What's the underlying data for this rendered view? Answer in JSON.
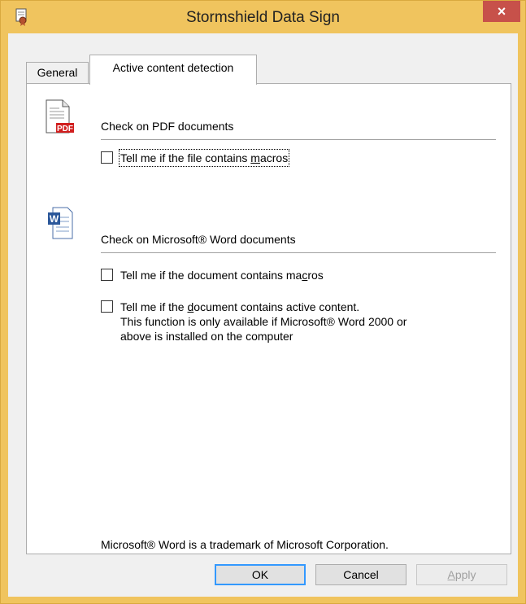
{
  "window": {
    "title": "Stormshield Data Sign",
    "close_glyph": "×",
    "app_icon": "certificate-seal-icon"
  },
  "tabs": [
    {
      "label": "General",
      "active": false
    },
    {
      "label": "Active content detection",
      "active": true
    }
  ],
  "pdf_section": {
    "icon": "pdf-document-icon",
    "heading": "Check on PDF documents",
    "option_macros": {
      "pre": "Tell me if the file contains ",
      "u": "m",
      "post": "acros",
      "checked": false
    }
  },
  "word_section": {
    "icon": "word-document-icon",
    "heading": "Check on Microsoft® Word documents",
    "option_macros": {
      "pre": "Tell me if the document contains ma",
      "u": "c",
      "post": "ros",
      "checked": false
    },
    "option_active": {
      "pre": "Tell me if the ",
      "u": "d",
      "post": "ocument contains active content.",
      "line2": "This function is only available if Microsoft® Word 2000 or",
      "line3": "above is installed on the computer",
      "checked": false
    }
  },
  "trademark_note": "Microsoft® Word is a trademark of Microsoft Corporation.",
  "buttons": {
    "ok": "OK",
    "cancel": "Cancel",
    "apply_u": "A",
    "apply_rest": "pply"
  },
  "colors": {
    "titlebar": "#f0c45e",
    "close": "#c7514a",
    "focus_border": "#3399ff"
  }
}
